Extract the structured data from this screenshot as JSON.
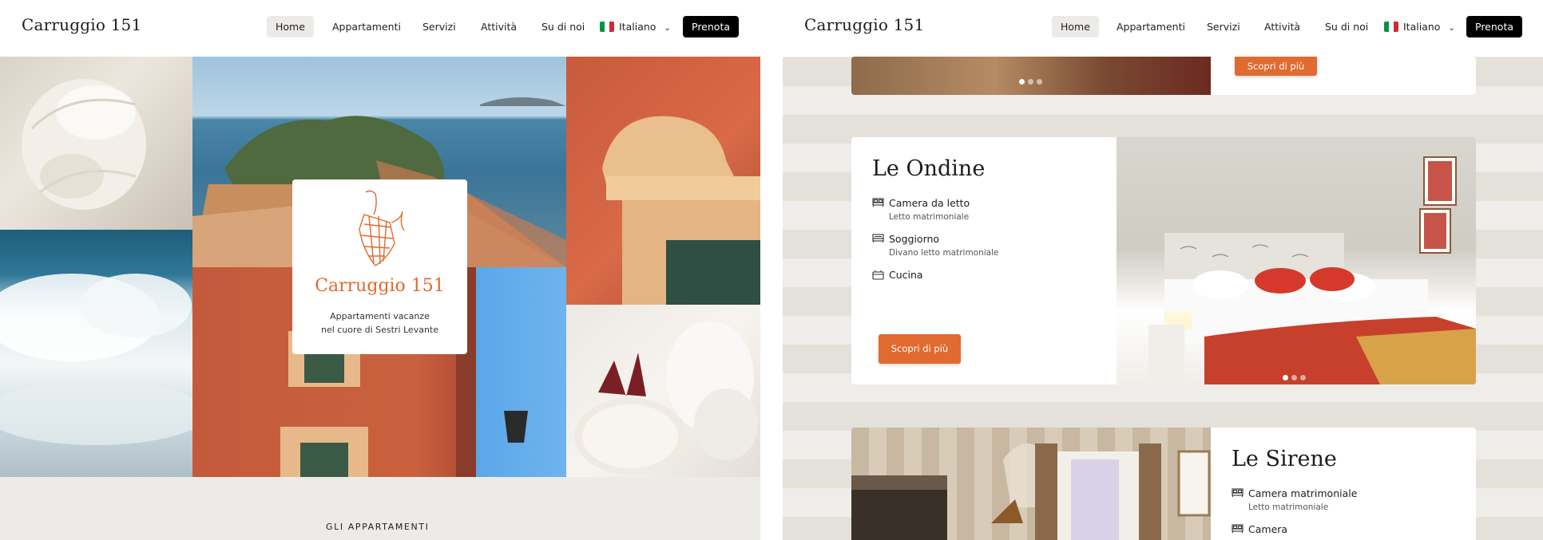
{
  "site": {
    "brand": "Carruggio 151"
  },
  "nav": {
    "items": [
      "Home",
      "Appartamenti",
      "Servizi",
      "Attività",
      "Su di noi"
    ],
    "language": "Italiano",
    "book_label": "Prenota"
  },
  "hero": {
    "title": "Carruggio 151",
    "subtitle_line1": "Appartamenti vacanze",
    "subtitle_line2": "nel cuore di Sestri Levante"
  },
  "section": {
    "label": "GLI APPARTAMENTI"
  },
  "apartments": [
    {
      "name": "Le Ondine",
      "rooms": [
        {
          "name": "Camera da letto",
          "detail": "Letto matrimoniale",
          "icon": "bed-icon"
        },
        {
          "name": "Soggiorno",
          "detail": "Divano letto matrimoniale",
          "icon": "sofa-bed-icon"
        },
        {
          "name": "Cucina",
          "detail": "",
          "icon": "kitchen-icon"
        }
      ],
      "cta": "Scopri di più"
    },
    {
      "name": "Le Sirene",
      "rooms": [
        {
          "name": "Camera matrimoniale",
          "detail": "Letto matrimoniale",
          "icon": "bed-icon"
        },
        {
          "name": "Camera",
          "detail": "",
          "icon": "bed-icon"
        }
      ]
    }
  ],
  "previous_card": {
    "cta": "Scopri di più"
  },
  "colors": {
    "accent": "#e06a2f",
    "book": "#000000",
    "beige": "#ecebe7"
  }
}
